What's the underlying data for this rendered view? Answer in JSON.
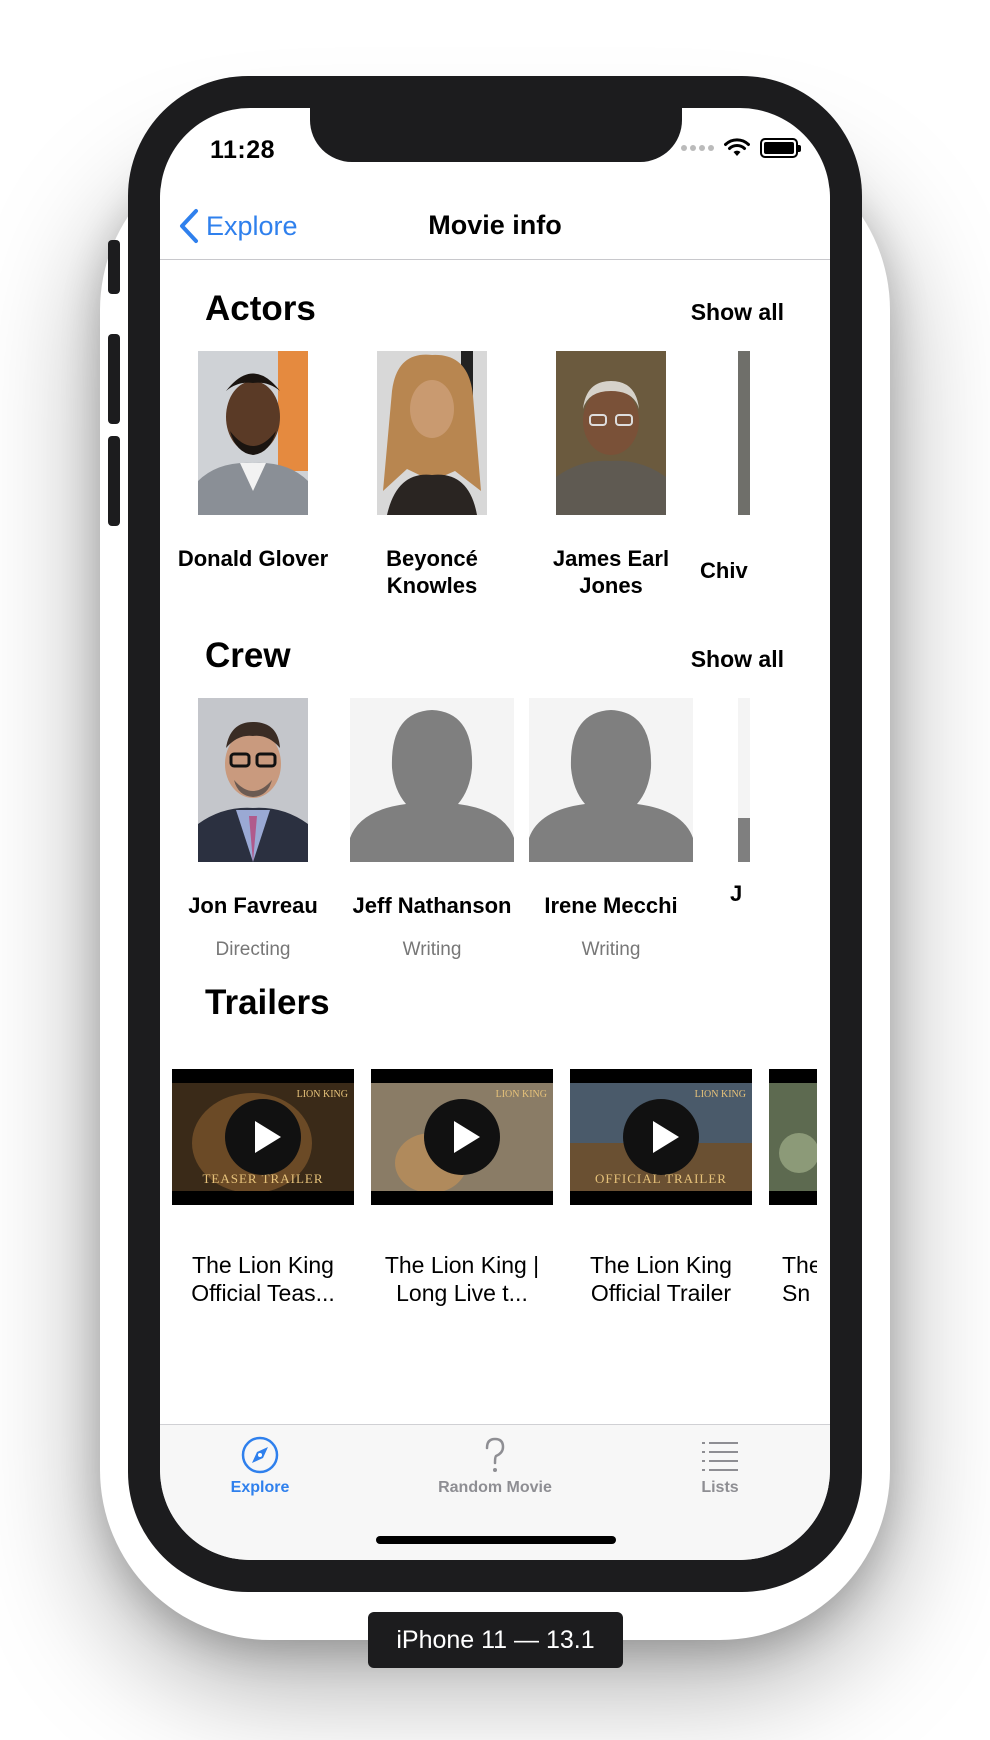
{
  "status_bar": {
    "time": "11:28"
  },
  "nav": {
    "back_label": "Explore",
    "title": "Movie info"
  },
  "actors": {
    "title": "Actors",
    "show_all": "Show all",
    "items": [
      {
        "name": "Donald Glover"
      },
      {
        "name": "Beyoncé Knowles"
      },
      {
        "name": "James Earl Jones"
      },
      {
        "name": "Chiv"
      }
    ]
  },
  "crew": {
    "title": "Crew",
    "show_all": "Show all",
    "items": [
      {
        "name": "Jon Favreau",
        "role": "Directing"
      },
      {
        "name": "Jeff Nathanson",
        "role": "Writing"
      },
      {
        "name": "Irene Mecchi",
        "role": "Writing"
      },
      {
        "name": "J",
        "role": ""
      }
    ]
  },
  "trailers": {
    "title": "Trailers",
    "items": [
      {
        "title": "The Lion King Official Teas...",
        "caption": "TEASER TRAILER",
        "logo": "LION KING"
      },
      {
        "title": "The Lion King | Long Live t...",
        "caption": "",
        "logo": "LION KING"
      },
      {
        "title": "The Lion King Official Trailer",
        "caption": "OFFICIAL TRAILER",
        "logo": "LION KING"
      },
      {
        "title": "The Sn",
        "caption": "",
        "logo": ""
      }
    ]
  },
  "tabbar": {
    "tabs": [
      {
        "label": "Explore",
        "icon": "compass-icon",
        "active": true
      },
      {
        "label": "Random Movie",
        "icon": "question-icon",
        "active": false
      },
      {
        "label": "Lists",
        "icon": "list-icon",
        "active": false
      }
    ],
    "active_color": "#2f80ed",
    "inactive_color": "#8e8e93"
  },
  "device_label": "iPhone 11 — 13.1"
}
